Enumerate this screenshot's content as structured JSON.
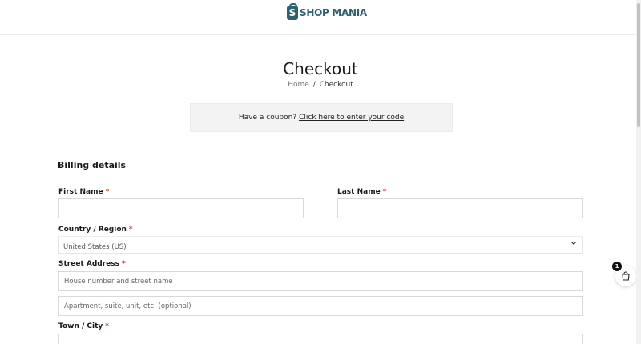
{
  "header": {
    "logo_mark": "S",
    "logo_text": "SHOP MANIA",
    "brand_color": "#2d6170"
  },
  "page": {
    "title": "Checkout"
  },
  "breadcrumb": {
    "home": "Home",
    "separator": "/",
    "current": "Checkout"
  },
  "coupon": {
    "prompt": "Have a coupon?",
    "link": "Click here to enter your code"
  },
  "billing": {
    "title": "Billing details",
    "required_mark": "*",
    "first_name": {
      "label": "First Name",
      "value": ""
    },
    "last_name": {
      "label": "Last Name",
      "value": ""
    },
    "country": {
      "label": "Country / Region",
      "value": "United States (US)"
    },
    "street": {
      "label": "Street Address",
      "line1_placeholder": "House number and street name",
      "line2_placeholder": "Apartment, suite, unit, etc. (optional)"
    },
    "town": {
      "label": "Town / City",
      "value": ""
    }
  },
  "cart": {
    "count": "1",
    "icon": "shopping-bag-icon"
  }
}
